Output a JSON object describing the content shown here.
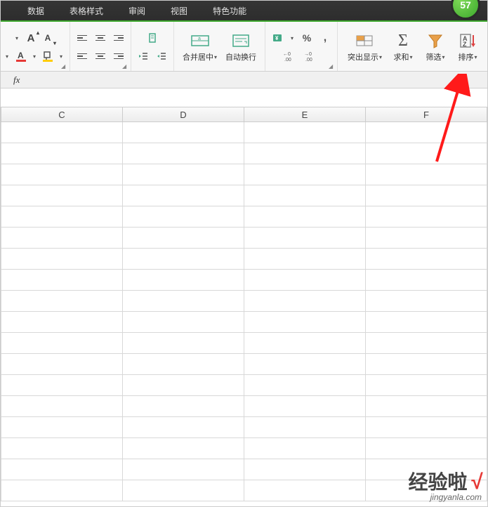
{
  "menu": {
    "items": [
      "数据",
      "表格样式",
      "审阅",
      "视图",
      "特色功能"
    ]
  },
  "update_badge": "57",
  "ribbon": {
    "font_increase": "A",
    "font_decrease": "A",
    "merge_center": "合并居中",
    "wrap_text": "自动换行",
    "percent_sign": "%",
    "increase_decimal": "←0\n.00",
    "decrease_decimal": "→0\n.00",
    "highlight": "突出显示",
    "sum": "求和",
    "filter": "筛选",
    "sort": "排序"
  },
  "formula_bar": {
    "fx": "fx"
  },
  "columns": [
    "C",
    "D",
    "E",
    "F"
  ],
  "row_count": 18,
  "watermark": {
    "text": "经验啦",
    "check": "√",
    "sub": "jingyanla.com"
  }
}
